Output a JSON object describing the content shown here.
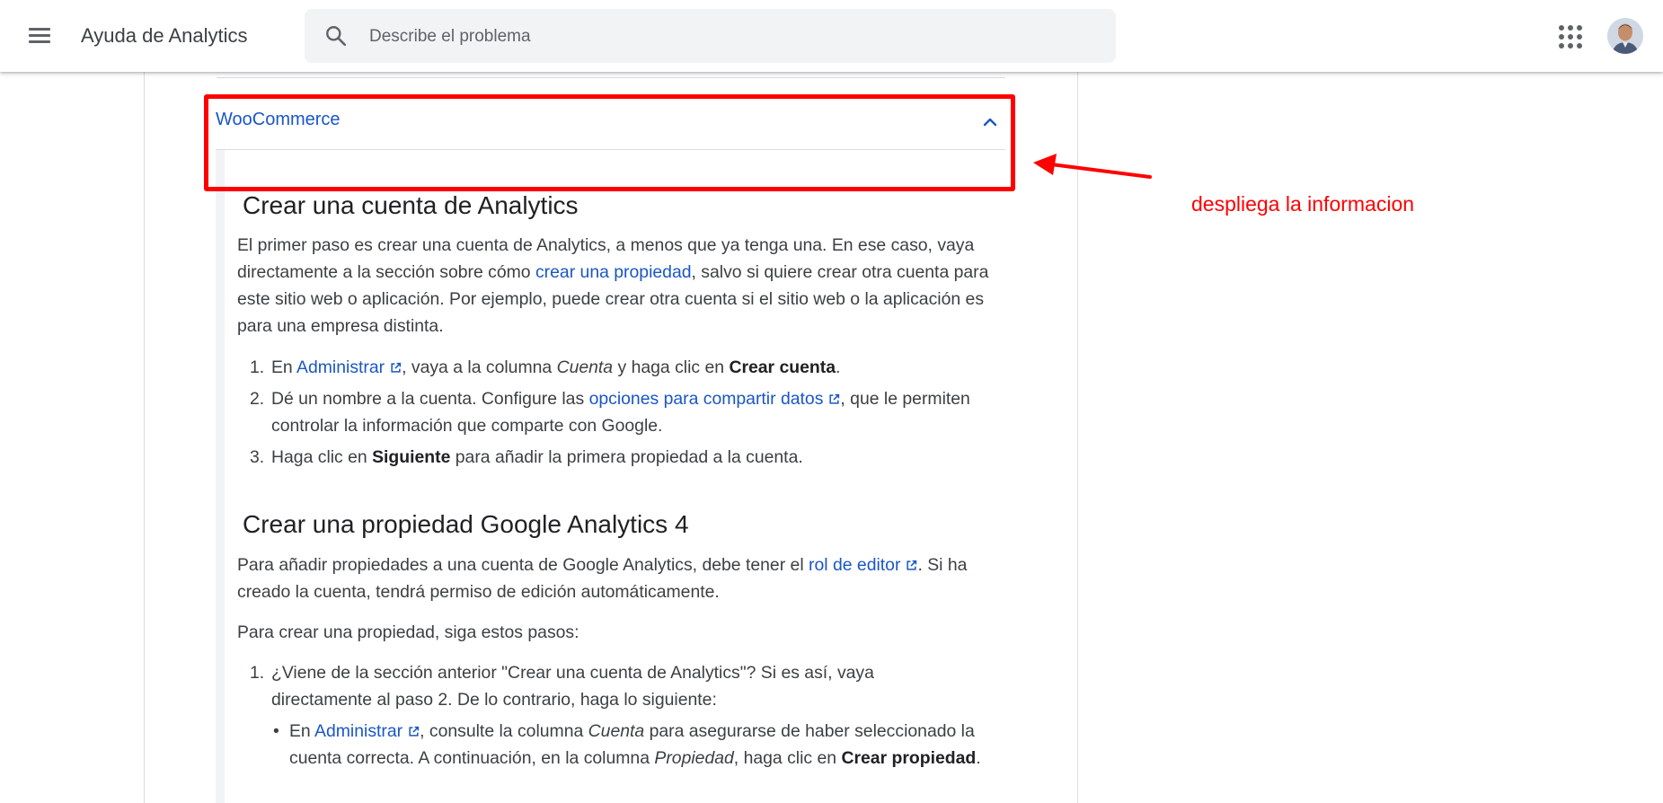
{
  "header": {
    "app_title": "Ayuda de Analytics",
    "search_placeholder": "Describe el problema"
  },
  "accordion": {
    "title": "WooCommerce",
    "expanded": true
  },
  "section1": {
    "heading": "Crear una cuenta de Analytics",
    "intro_before": "El primer paso es crear una cuenta de Analytics, a menos que ya tenga una. En ese caso, vaya directamente a la sección sobre cómo ",
    "intro_link": "crear una propiedad",
    "intro_after": ", salvo si quiere crear otra cuenta para este sitio web o aplicación. Por ejemplo, puede crear otra cuenta si el sitio web o la aplicación es para una empresa distinta.",
    "steps": [
      {
        "num": "1.",
        "pre": "En ",
        "link": "Administrar",
        "mid": ", vaya a la columna ",
        "em": "Cuenta",
        "post": " y haga clic en ",
        "bold": "Crear cuenta",
        "end": "."
      },
      {
        "num": "2.",
        "pre": "Dé un nombre a la cuenta. Configure las ",
        "link": "opciones para compartir datos",
        "post": ", que le permiten controlar la información que comparte con Google."
      },
      {
        "num": "3.",
        "pre": "Haga clic en ",
        "bold": "Siguiente",
        "post": " para añadir la primera propiedad a la cuenta."
      }
    ]
  },
  "section2": {
    "heading": "Crear una propiedad Google Analytics 4",
    "para1_before": "Para añadir propiedades a una cuenta de Google Analytics, debe tener el ",
    "para1_link": "rol de editor",
    "para1_after": ". Si ha creado la cuenta, tendrá permiso de edición automáticamente.",
    "para2": "Para crear una propiedad, siga estos pasos:",
    "step1_num": "1.",
    "step1_text": "¿Viene de la sección anterior \"Crear una cuenta de Analytics\"? Si es así, vaya directamente al paso 2.  De lo contrario, haga lo siguiente:",
    "bullet": {
      "pre": "En ",
      "link": "Administrar",
      "mid": ", consulte la columna ",
      "em1": "Cuenta",
      "mid2": " para asegurarse de haber seleccionado la cuenta correcta. A continuación, en la columna ",
      "em2": "Propiedad",
      "mid3": ", haga clic en ",
      "bold": "Crear propiedad",
      "end": "."
    }
  },
  "annotation": {
    "text": "despliega la informacion",
    "color": "#ff0000"
  },
  "icons": [
    "menu-icon",
    "search-icon",
    "apps-grid-icon",
    "avatar",
    "chevron-up-icon",
    "external-link-icon",
    "red-arrow"
  ],
  "colors": {
    "link": "#1a56c6",
    "annotation": "#ff0000",
    "search_bg": "#f1f3f4"
  }
}
